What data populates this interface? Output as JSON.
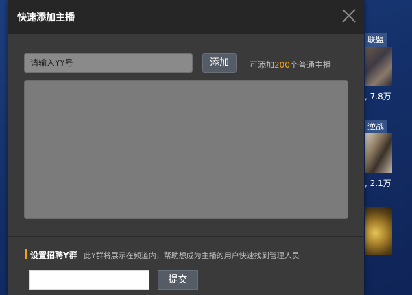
{
  "background": {
    "cards": [
      {
        "tag": "联盟",
        "count": ", 7.8万"
      },
      {
        "tag": "逆战",
        "count": ", 2.1万"
      }
    ]
  },
  "modal": {
    "title": "快速添加主播",
    "close_icon": "close-icon",
    "yy_input": {
      "value": "",
      "placeholder": "请输入YY号"
    },
    "add_button": "添加",
    "hint": {
      "prefix": "可添加",
      "count": "200",
      "suffix": "个普通主播"
    },
    "recruit": {
      "title": "设置招聘Y群",
      "description": "此Y群将展示在频道内，帮助想成为主播的用户快速找到管理人员",
      "input_value": "",
      "submit_button": "提交"
    }
  },
  "colors": {
    "accent": "#f0a21a",
    "modal_bg": "#3a3a3a",
    "header_bg": "#262626",
    "button_bg": "#565c66"
  }
}
